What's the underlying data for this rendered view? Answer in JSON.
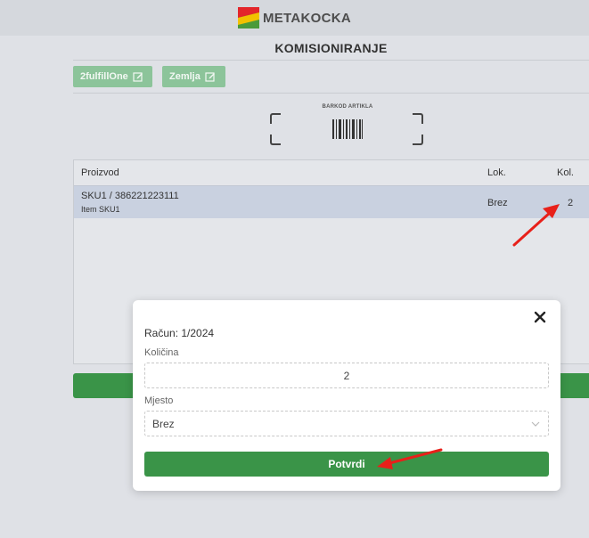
{
  "header": {
    "brand": "METAKOCKA"
  },
  "page": {
    "title": "KOMISIONIRANJE"
  },
  "tags": [
    {
      "label": "2fulfillOne"
    },
    {
      "label": "Zemlja"
    }
  ],
  "scanner": {
    "label": "BARKOD ARTIKLA"
  },
  "table": {
    "columns": {
      "product": "Proizvod",
      "location": "Lok.",
      "quantity": "Kol."
    },
    "rows": [
      {
        "sku": "SKU1 / 386221223111",
        "name": "Item SKU1",
        "location": "Brez",
        "quantity": "2"
      }
    ]
  },
  "modal": {
    "invoice": "Račun: 1/2024",
    "quantity_label": "Količina",
    "quantity_value": "2",
    "location_label": "Mjesto",
    "location_value": "Brez",
    "confirm_label": "Potvrdi"
  },
  "colors": {
    "primary_green": "#3a9448",
    "tag_green": "#8cc49a",
    "row_highlight": "#c9d1e0",
    "annotation_red": "#e8201a"
  }
}
